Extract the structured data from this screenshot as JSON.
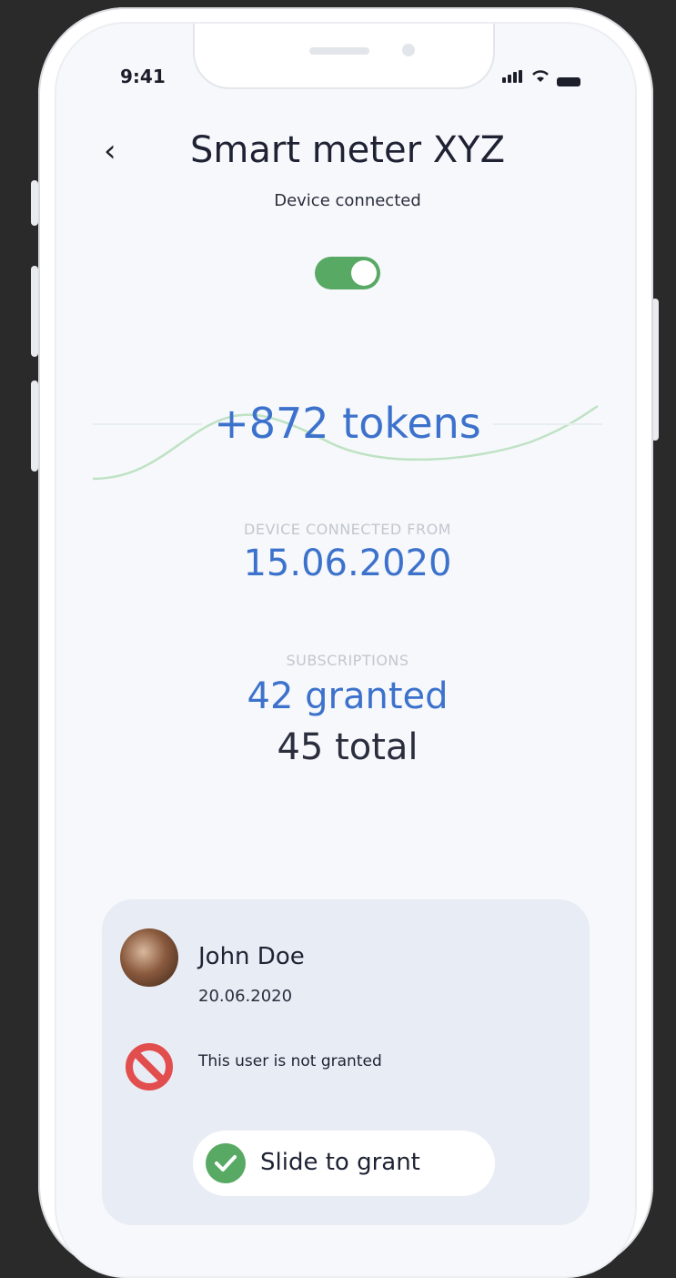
{
  "status_bar": {
    "time": "9:41"
  },
  "header": {
    "back_icon": "‹",
    "title": "Smart meter XYZ",
    "subtitle": "Device connected"
  },
  "toggle": {
    "state": "on",
    "color": "#58a964"
  },
  "tokens": {
    "value": "+872 tokens"
  },
  "connected_from": {
    "label": "DEVICE CONNECTED FROM",
    "date": "15.06.2020"
  },
  "subscriptions": {
    "label": "SUBSCRIPTIONS",
    "granted": "42 granted",
    "total": "45 total"
  },
  "request_card": {
    "user_name": "John Doe",
    "date": "20.06.2020",
    "status_text": "This user is not granted",
    "slide_label": "Slide to grant"
  },
  "colors": {
    "accent": "#3d72cc",
    "success": "#58a964",
    "danger": "#e24d4d"
  }
}
